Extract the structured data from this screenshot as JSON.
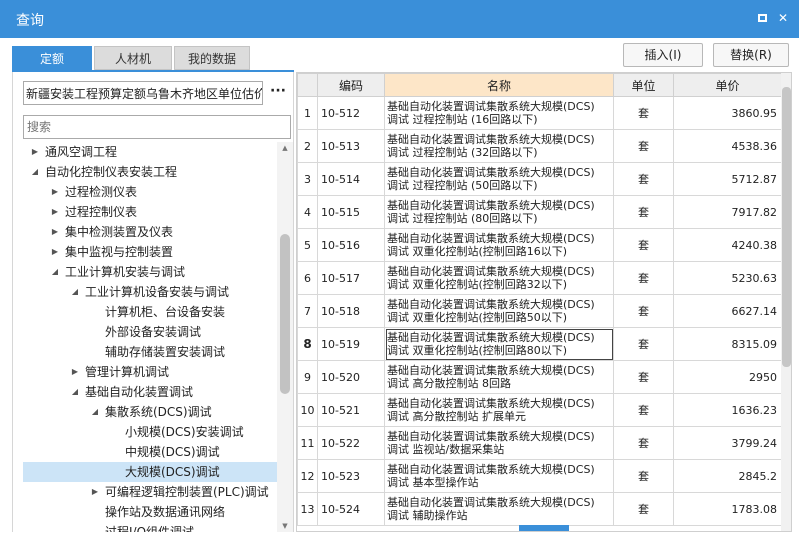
{
  "window": {
    "title": "查询"
  },
  "tabs": [
    {
      "label": "定额",
      "active": true
    },
    {
      "label": "人材机",
      "active": false
    },
    {
      "label": "我的数据",
      "active": false
    }
  ],
  "actions": {
    "insert_label": "插入(I)",
    "replace_label": "替换(R)"
  },
  "left": {
    "quota_book": "新疆安装工程预算定额乌鲁木齐地区单位估价表",
    "more_label": "···",
    "search_placeholder": "搜索"
  },
  "tree": [
    {
      "label": "通风空调工程",
      "arrow": "▶",
      "level": 0
    },
    {
      "label": "自动化控制仪表安装工程",
      "arrow": "◢",
      "level": 0
    },
    {
      "label": "过程检测仪表",
      "arrow": "▶",
      "level": 1
    },
    {
      "label": "过程控制仪表",
      "arrow": "▶",
      "level": 1
    },
    {
      "label": "集中检测装置及仪表",
      "arrow": "▶",
      "level": 1
    },
    {
      "label": "集中监视与控制装置",
      "arrow": "▶",
      "level": 1
    },
    {
      "label": "工业计算机安装与调试",
      "arrow": "◢",
      "level": 1
    },
    {
      "label": "工业计算机设备安装与调试",
      "arrow": "◢",
      "level": 2
    },
    {
      "label": "计算机柜、台设备安装",
      "arrow": "",
      "level": 3
    },
    {
      "label": "外部设备安装调试",
      "arrow": "",
      "level": 3
    },
    {
      "label": "辅助存储装置安装调试",
      "arrow": "",
      "level": 3
    },
    {
      "label": "管理计算机调试",
      "arrow": "▶",
      "level": 2
    },
    {
      "label": "基础自动化装置调试",
      "arrow": "◢",
      "level": 2
    },
    {
      "label": "集散系统(DCS)调试",
      "arrow": "◢",
      "level": 3
    },
    {
      "label": "小规模(DCS)安装调试",
      "arrow": "",
      "level": 4
    },
    {
      "label": "中规模(DCS)调试",
      "arrow": "",
      "level": 4
    },
    {
      "label": "大规模(DCS)调试",
      "arrow": "",
      "level": 4,
      "selected": true
    },
    {
      "label": "可编程逻辑控制装置(PLC)调试",
      "arrow": "▶",
      "level": 3
    },
    {
      "label": "操作站及数据通讯网络",
      "arrow": "",
      "level": 3
    },
    {
      "label": "过程I/O组件调试",
      "arrow": "",
      "level": 3
    }
  ],
  "grid": {
    "columns": [
      "",
      "编码",
      "名称",
      "单位",
      "单价"
    ],
    "rows": [
      {
        "no": "1",
        "code": "10-512",
        "name1": "基础自动化装置调试集散系统大规模(DCS)",
        "name2": "调试 过程控制站 (16回路以下)",
        "unit": "套",
        "price": "3860.95"
      },
      {
        "no": "2",
        "code": "10-513",
        "name1": "基础自动化装置调试集散系统大规模(DCS)",
        "name2": "调试 过程控制站 (32回路以下)",
        "unit": "套",
        "price": "4538.36"
      },
      {
        "no": "3",
        "code": "10-514",
        "name1": "基础自动化装置调试集散系统大规模(DCS)",
        "name2": "调试 过程控制站 (50回路以下)",
        "unit": "套",
        "price": "5712.87"
      },
      {
        "no": "4",
        "code": "10-515",
        "name1": "基础自动化装置调试集散系统大规模(DCS)",
        "name2": "调试 过程控制站 (80回路以下)",
        "unit": "套",
        "price": "7917.82"
      },
      {
        "no": "5",
        "code": "10-516",
        "name1": "基础自动化装置调试集散系统大规模(DCS)",
        "name2": "调试 双重化控制站(控制回路16以下)",
        "unit": "套",
        "price": "4240.38"
      },
      {
        "no": "6",
        "code": "10-517",
        "name1": "基础自动化装置调试集散系统大规模(DCS)",
        "name2": "调试 双重化控制站(控制回路32以下)",
        "unit": "套",
        "price": "5230.63"
      },
      {
        "no": "7",
        "code": "10-518",
        "name1": "基础自动化装置调试集散系统大规模(DCS)",
        "name2": "调试 双重化控制站(控制回路50以下)",
        "unit": "套",
        "price": "6627.14"
      },
      {
        "no": "8",
        "code": "10-519",
        "name1": "基础自动化装置调试集散系统大规模(DCS)",
        "name2": "调试 双重化控制站(控制回路80以下)",
        "unit": "套",
        "price": "8315.09",
        "current": true
      },
      {
        "no": "9",
        "code": "10-520",
        "name1": "基础自动化装置调试集散系统大规模(DCS)",
        "name2": "调试 高分散控制站 8回路",
        "unit": "套",
        "price": "2950"
      },
      {
        "no": "10",
        "code": "10-521",
        "name1": "基础自动化装置调试集散系统大规模(DCS)",
        "name2": "调试 高分散控制站 扩展单元",
        "unit": "套",
        "price": "1636.23"
      },
      {
        "no": "11",
        "code": "10-522",
        "name1": "基础自动化装置调试集散系统大规模(DCS)",
        "name2": "调试 监视站/数据采集站",
        "unit": "套",
        "price": "3799.24"
      },
      {
        "no": "12",
        "code": "10-523",
        "name1": "基础自动化装置调试集散系统大规模(DCS)",
        "name2": "调试 基本型操作站",
        "unit": "套",
        "price": "2845.2"
      },
      {
        "no": "13",
        "code": "10-524",
        "name1": "基础自动化装置调试集散系统大规模(DCS)",
        "name2": "调试 辅助操作站",
        "unit": "套",
        "price": "1783.08"
      }
    ]
  }
}
